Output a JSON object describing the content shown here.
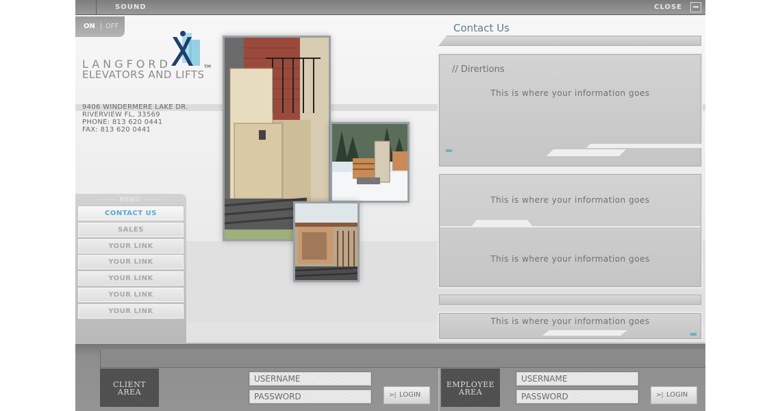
{
  "topbar": {
    "sound_label": "SOUND",
    "close_label": "CLOSE"
  },
  "sound_toggle": {
    "on": "ON",
    "separator": "|",
    "off": "OFF"
  },
  "logo": {
    "line1": "LANGFORD",
    "line2": "ELEVATORS AND LIFTS",
    "tm": "TM"
  },
  "address": {
    "street": "9406 WINDERMERE LAKE DR.",
    "city": "RIVERVIEW FL, 33569",
    "phone": "PHONE: 813 620 0441",
    "fax": "FAX: 813 620 0441"
  },
  "menu": {
    "title": "MENU",
    "items": [
      {
        "label": "CONTACT US"
      },
      {
        "label": "SALES"
      },
      {
        "label": "YOUR LINK"
      },
      {
        "label": "YOUR LINK"
      },
      {
        "label": "YOUR LINK"
      },
      {
        "label": "YOUR LINK"
      },
      {
        "label": "YOUR LINK"
      }
    ]
  },
  "content": {
    "title": "Contact Us",
    "directions_heading": "// Dirertions",
    "info1": "This is where your information goes",
    "info2": "This is where your information goes",
    "info3": "This is where your information goes",
    "info4": "This is where your information goes"
  },
  "login": {
    "client": {
      "area_line1": "CLIENT",
      "area_line2": "AREA",
      "username": "USERNAME",
      "password": "PASSWORD",
      "button": "LOGIN"
    },
    "employee": {
      "area_line1": "EMPLOYEE",
      "area_line2": "AREA",
      "username": "USERNAME",
      "password": "PASSWORD",
      "button": "LOGIN"
    }
  },
  "colors": {
    "accent": "#55aad2",
    "title": "#5a7e8e",
    "teal_marker": "#6fb0bd"
  }
}
